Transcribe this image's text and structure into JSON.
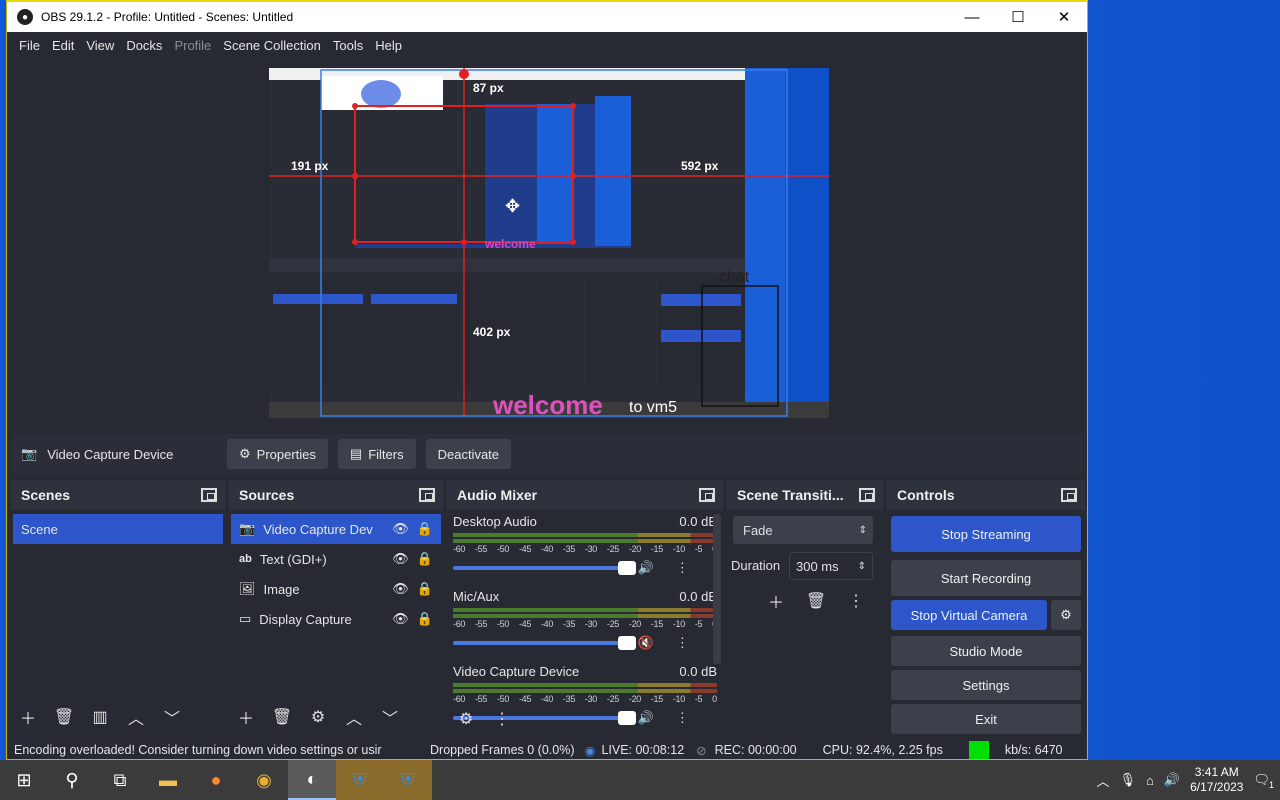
{
  "window": {
    "title": "OBS 29.1.2 - Profile: Untitled - Scenes: Untitled",
    "minimize": "—",
    "maximize": "☐",
    "close": "✕"
  },
  "menu": [
    "File",
    "Edit",
    "View",
    "Docks",
    "Profile",
    "Scene Collection",
    "Tools",
    "Help"
  ],
  "preview": {
    "label_top": "87 px",
    "label_left": "191 px",
    "label_right": "592 px",
    "label_bottom": "402 px",
    "overlay_text1": "welcome",
    "overlay_text2": "to vm5",
    "chat_text": "chat"
  },
  "source_toolbar": {
    "source_name": "Video Capture Device",
    "properties": "Properties",
    "filters": "Filters",
    "deactivate": "Deactivate"
  },
  "scenes": {
    "title": "Scenes",
    "items": [
      "Scene"
    ]
  },
  "sources": {
    "title": "Sources",
    "items": [
      {
        "name": "Video Capture Dev",
        "icon": "camera-icon"
      },
      {
        "name": "Text (GDI+)",
        "icon": "text-icon"
      },
      {
        "name": "Image",
        "icon": "image-icon"
      },
      {
        "name": "Display Capture",
        "icon": "monitor-icon"
      }
    ]
  },
  "mixer": {
    "title": "Audio Mixer",
    "ticks": [
      "-60",
      "-55",
      "-50",
      "-45",
      "-40",
      "-35",
      "-30",
      "-25",
      "-20",
      "-15",
      "-10",
      "-5",
      "0"
    ],
    "channels": [
      {
        "name": "Desktop Audio",
        "level": "0.0 dB",
        "muted": false,
        "volume": 0.95
      },
      {
        "name": "Mic/Aux",
        "level": "0.0 dB",
        "muted": true,
        "volume": 0.95
      },
      {
        "name": "Video Capture Device",
        "level": "0.0 dB",
        "muted": false,
        "volume": 0.95
      }
    ]
  },
  "transitions": {
    "title": "Scene Transiti...",
    "selected": "Fade",
    "duration_label": "Duration",
    "duration_value": "300 ms"
  },
  "controls": {
    "title": "Controls",
    "stop_streaming": "Stop Streaming",
    "start_recording": "Start Recording",
    "stop_virtual_camera": "Stop Virtual Camera",
    "studio_mode": "Studio Mode",
    "settings": "Settings",
    "exit": "Exit"
  },
  "status": {
    "message": "Encoding overloaded! Consider turning down video settings or usir",
    "dropped": "Dropped Frames 0 (0.0%)",
    "live": "LIVE: 00:08:12",
    "rec": "REC: 00:00:00",
    "cpu": "CPU: 92.4%, 2.25 fps",
    "bitrate": "kb/s: 6470",
    "health_color": "#00e000"
  },
  "taskbar": {
    "time": "3:41 AM",
    "date": "6/17/2023",
    "notifications": "1"
  }
}
